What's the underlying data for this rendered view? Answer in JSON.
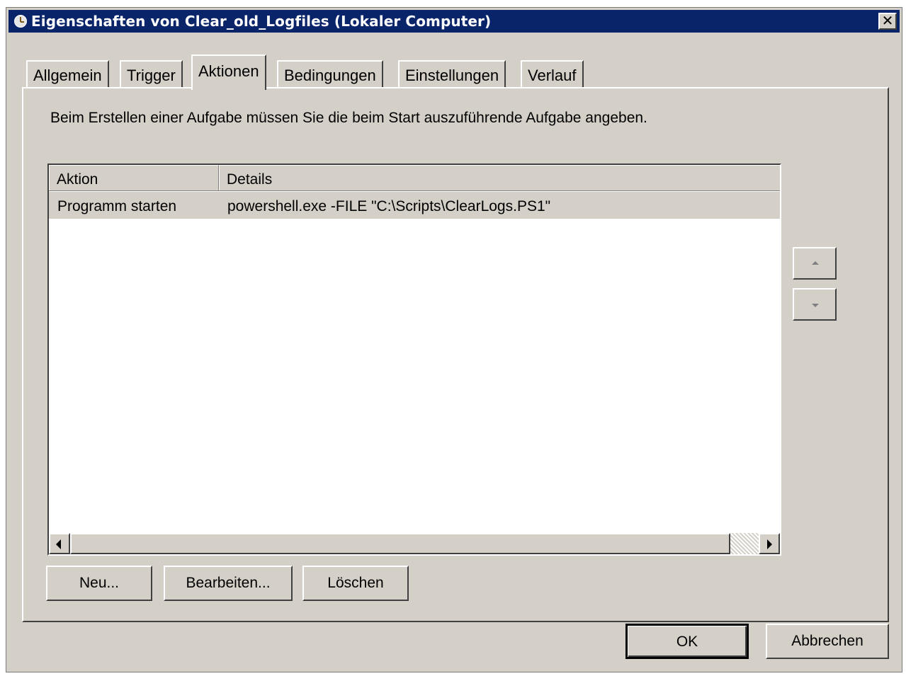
{
  "window": {
    "title": "Eigenschaften von Clear_old_Logfiles (Lokaler Computer)",
    "close_glyph": "✕"
  },
  "tabs": [
    {
      "label": "Allgemein",
      "active": false
    },
    {
      "label": "Trigger",
      "active": false
    },
    {
      "label": "Aktionen",
      "active": true
    },
    {
      "label": "Bedingungen",
      "active": false
    },
    {
      "label": "Einstellungen",
      "active": false
    },
    {
      "label": "Verlauf",
      "active": false
    }
  ],
  "actions_tab": {
    "description": "Beim Erstellen einer Aufgabe müssen Sie die beim Start auszuführende Aufgabe angeben.",
    "table": {
      "columns": [
        "Aktion",
        "Details"
      ],
      "rows": [
        {
          "aktion": "Programm starten",
          "details": "powershell.exe -FILE \"C:\\Scripts\\ClearLogs.PS1\"",
          "selected": true
        }
      ]
    },
    "buttons": {
      "new": "Neu...",
      "edit": "Bearbeiten...",
      "delete": "Löschen"
    }
  },
  "footer": {
    "ok": "OK",
    "cancel": "Abbrechen"
  }
}
